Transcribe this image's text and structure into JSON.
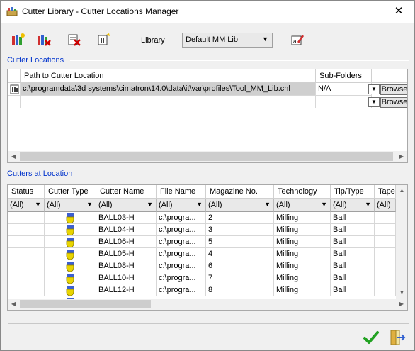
{
  "window": {
    "title": "Cutter Library - Cutter Locations Manager",
    "close_glyph": "✕"
  },
  "toolbar": {
    "library_label": "Library",
    "library_value": "Default MM Lib",
    "icons": [
      "add-location-icon",
      "remove-location-icon",
      "delete-icon",
      "edit-icon",
      "edit-library-icon"
    ]
  },
  "locations": {
    "group_label": "Cutter Locations",
    "columns": [
      "Path to Cutter Location",
      "Sub-Folders"
    ],
    "rows": [
      {
        "path": "c:\\programdata\\3d systems\\cimatron\\14.0\\data\\it\\var\\profiles\\Tool_MM_Lib.chl",
        "subfolders": "N/A",
        "browse": "Browse"
      },
      {
        "path": "",
        "subfolders": "",
        "browse": "Browse"
      }
    ]
  },
  "cutters": {
    "group_label": "Cutters at Location",
    "columns": [
      "Status",
      "Cutter Type",
      "Cutter Name",
      "File Name",
      "Magazine No.",
      "Technology",
      "Tip/Type",
      "Tape"
    ],
    "filters": [
      "(All)",
      "(All)",
      "(All)",
      "(All)",
      "(All)",
      "(All)",
      "(All)",
      "(All)"
    ],
    "rows": [
      {
        "name": "BALL03-H",
        "file": "c:\\progra...",
        "mag": "2",
        "tech": "Milling",
        "tip": "Ball"
      },
      {
        "name": "BALL04-H",
        "file": "c:\\progra...",
        "mag": "3",
        "tech": "Milling",
        "tip": "Ball"
      },
      {
        "name": "BALL06-H",
        "file": "c:\\progra...",
        "mag": "5",
        "tech": "Milling",
        "tip": "Ball"
      },
      {
        "name": "BALL05-H",
        "file": "c:\\progra...",
        "mag": "4",
        "tech": "Milling",
        "tip": "Ball"
      },
      {
        "name": "BALL08-H",
        "file": "c:\\progra...",
        "mag": "6",
        "tech": "Milling",
        "tip": "Ball"
      },
      {
        "name": "BALL10-H",
        "file": "c:\\progra...",
        "mag": "7",
        "tech": "Milling",
        "tip": "Ball"
      },
      {
        "name": "BALL12-H",
        "file": "c:\\progra...",
        "mag": "8",
        "tech": "Milling",
        "tip": "Ball"
      }
    ]
  },
  "colors": {
    "group_label": "#0033cc",
    "ok": "#22a222",
    "cutter_icon": "#e8d400"
  }
}
